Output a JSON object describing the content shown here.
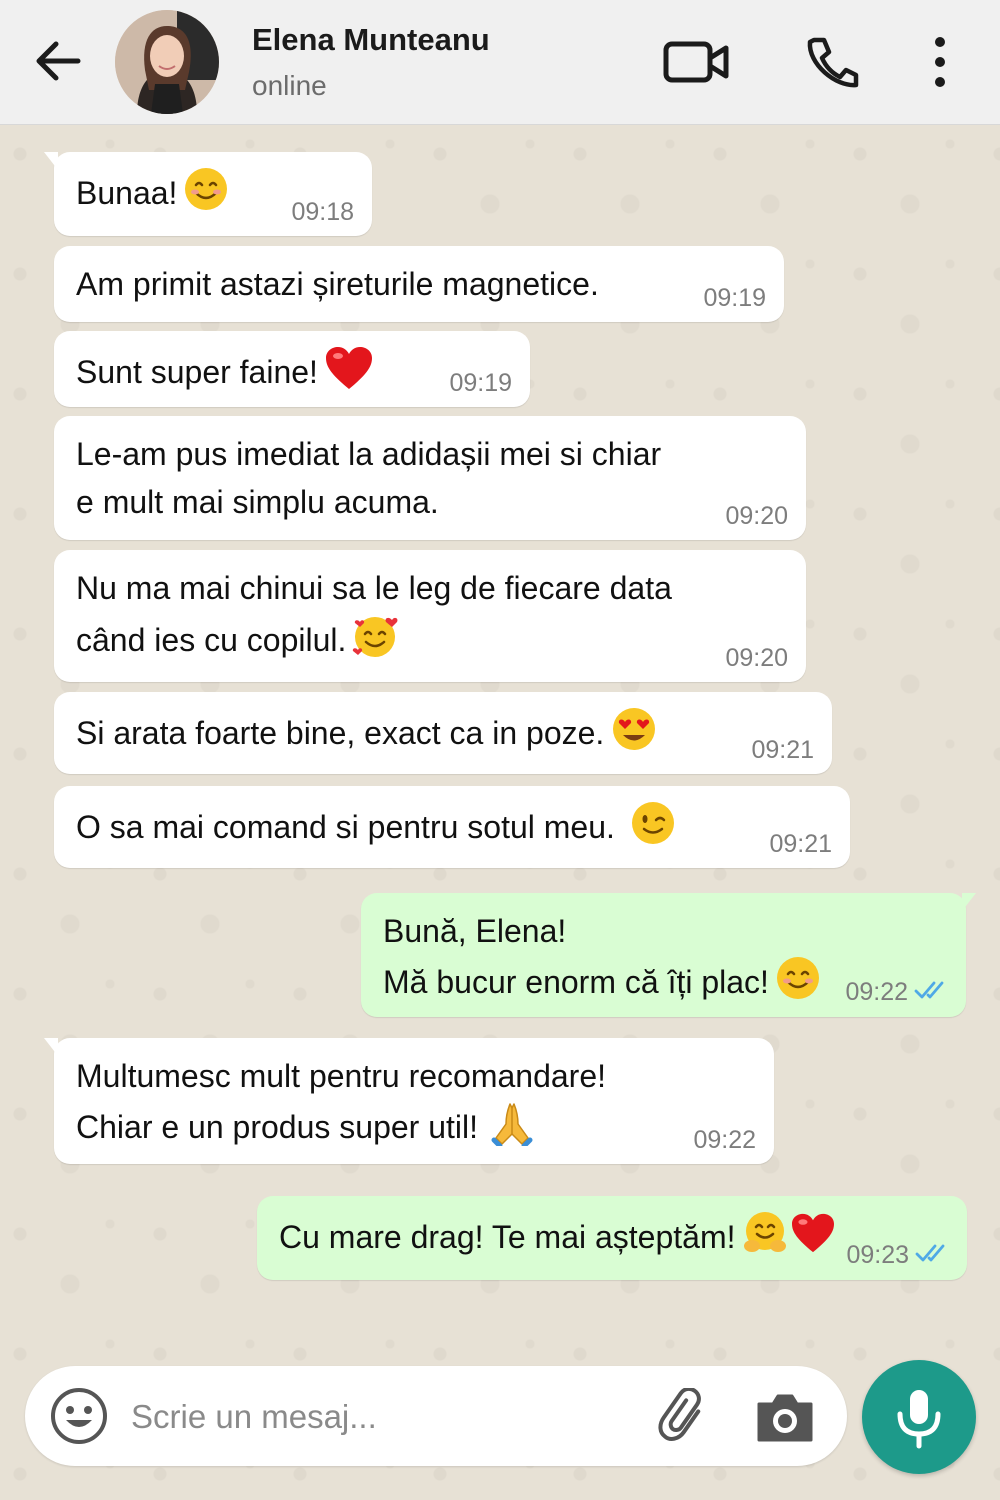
{
  "header": {
    "contact_name": "Elena Munteanu",
    "status": "online",
    "icons": [
      "back-arrow-icon",
      "video-call-icon",
      "phone-icon",
      "more-vertical-icon"
    ]
  },
  "messages": [
    {
      "dir": "in",
      "lines": [
        "Bunaa!"
      ],
      "emoji": "smiling-face",
      "time": "09:18"
    },
    {
      "dir": "in",
      "lines": [
        "Am primit astazi șireturile magnetice."
      ],
      "time": "09:19"
    },
    {
      "dir": "in",
      "lines": [
        "Sunt super faine!"
      ],
      "emoji": "red-heart",
      "time": "09:19"
    },
    {
      "dir": "in",
      "lines": [
        "Le-am pus imediat la adidașii mei si chiar",
        "e mult mai simplu acuma."
      ],
      "time": "09:20"
    },
    {
      "dir": "in",
      "lines": [
        "Nu ma mai chinui sa le leg de fiecare data",
        "când ies cu copilul."
      ],
      "emoji": "smiling-face-with-hearts",
      "time": "09:20"
    },
    {
      "dir": "in",
      "lines": [
        "Si arata foarte bine, exact ca in poze."
      ],
      "emoji": "heart-eyes",
      "time": "09:21"
    },
    {
      "dir": "in",
      "lines": [
        "O sa mai comand si pentru sotul meu."
      ],
      "emoji": "winking-face",
      "time": "09:21"
    },
    {
      "dir": "out",
      "lines": [
        "Bună, Elena!",
        "Mă bucur enorm că îți plac!"
      ],
      "emoji": "smiling-face",
      "time": "09:22",
      "read": true
    },
    {
      "dir": "in",
      "lines": [
        "Multumesc mult pentru recomandare!",
        "Chiar e un produs super util!"
      ],
      "emoji": "folded-hands",
      "time": "09:22"
    },
    {
      "dir": "out",
      "lines": [
        "Cu mare drag! Te mai așteptăm!"
      ],
      "emoji": "hugging-face + red-heart",
      "time": "09:23",
      "read": true
    }
  ],
  "composer": {
    "placeholder": "Scrie un mesaj...",
    "icons": [
      "emoji-icon",
      "attach-icon",
      "camera-icon",
      "mic-icon"
    ]
  },
  "colors": {
    "incoming_bubble": "#ffffff",
    "outgoing_bubble": "#d9fdd3",
    "read_ticks": "#4fa9e6",
    "mic_button": "#1d9a8a",
    "header_bg": "#f0f0f0"
  }
}
